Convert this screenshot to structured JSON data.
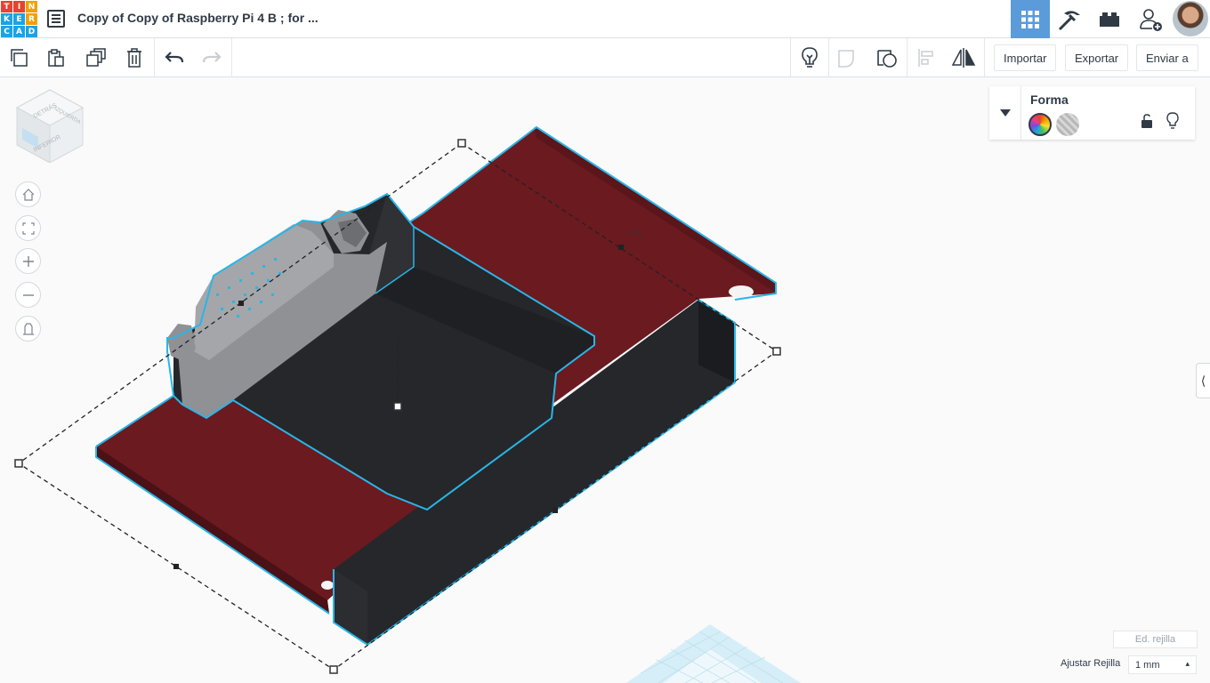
{
  "app": {
    "logo_letters": [
      "T",
      "I",
      "N",
      "K",
      "E",
      "R",
      "C",
      "A",
      "D"
    ],
    "logo_colors": [
      "#e8432e",
      "#e8432e",
      "#f4a000",
      "#1ba3e5",
      "#1ba3e5",
      "#f4a000",
      "#1ba3e5",
      "#1ba3e5",
      "#1ba3e5"
    ],
    "title": "Copy of Copy of Raspberry Pi 4 B ; for ..."
  },
  "modes": [
    {
      "name": "3d-design-icon",
      "active": true
    },
    {
      "name": "codeblocks-icon",
      "active": false
    },
    {
      "name": "bricks-icon",
      "active": false
    },
    {
      "name": "add-user-icon",
      "active": false
    }
  ],
  "toolbar": {
    "importar": "Importar",
    "exportar": "Exportar",
    "enviar_a": "Enviar a"
  },
  "viewcube": {
    "faces": [
      "DETRÁS",
      "IZQUIERDA",
      "INFERIOR"
    ]
  },
  "shape_panel": {
    "title": "Forma",
    "solid_colors": "rainbow",
    "hole_color": "#b8b8b8"
  },
  "grid": {
    "edit_label": "Ed. rejilla",
    "snap_label": "Ajustar Rejilla",
    "snap_value": "1 mm"
  },
  "scene": {
    "board_color": "#6b1a20",
    "selection_color": "#29b6e8",
    "part_color": "#25272b",
    "connector_color": "#9a9a9a"
  }
}
